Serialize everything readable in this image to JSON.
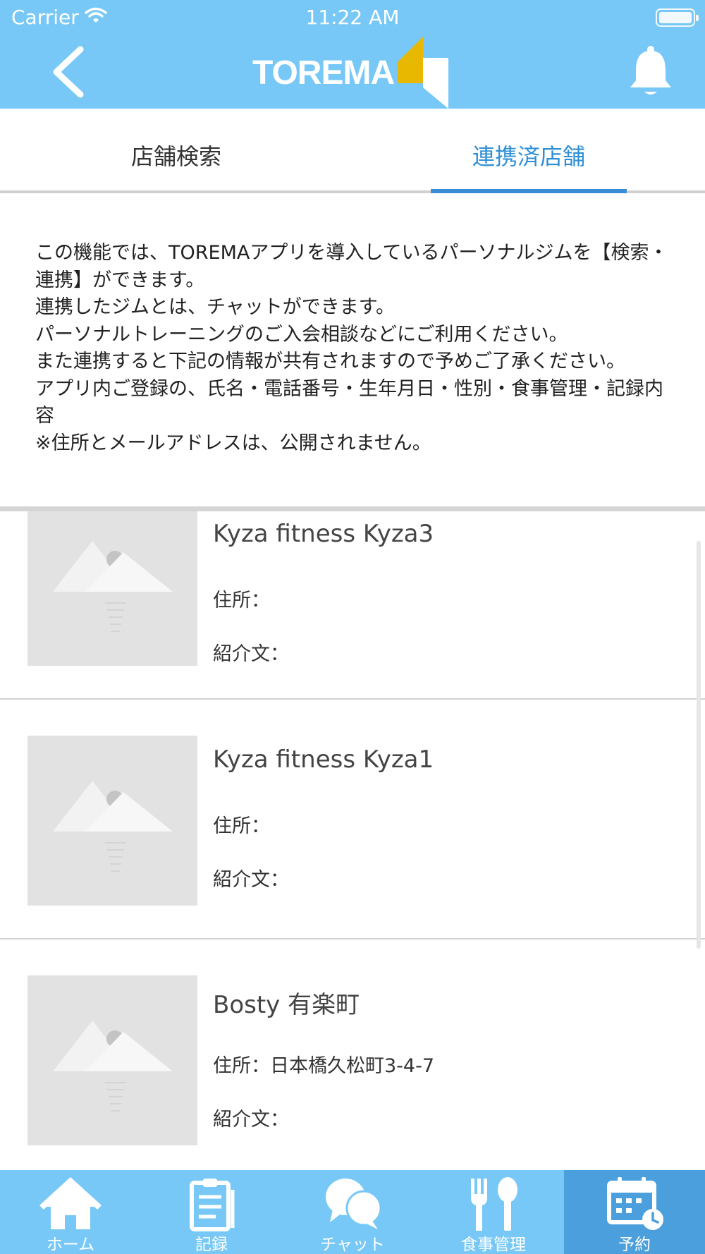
{
  "status_bar": {
    "carrier": "Carrier",
    "time": "11:22 AM"
  },
  "header": {
    "logo_text": "TOREMA"
  },
  "tabs": [
    {
      "label": "店舗検索",
      "active": false
    },
    {
      "label": "連携済店舗",
      "active": true
    }
  ],
  "description": "この機能では、TOREMAアプリを導入しているパーソナルジムを【検索・連携】ができます。\n連携したジムとは、チャットができます。\nパーソナルトレーニングのご入会相談などにご利用ください。\nまた連携すると下記の情報が共有されますので予めご了承ください。\nアプリ内ご登録の、氏名・電話番号・生年月日・性別・食事管理・記録内容\n※住所とメールアドレスは、公開されません。",
  "gyms": [
    {
      "name": "Kyza fitness Kyza3",
      "address": "住所：",
      "intro": "紹介文："
    },
    {
      "name": "Kyza fitness Kyza1",
      "address": "住所：",
      "intro": "紹介文："
    },
    {
      "name": "Bosty 有楽町",
      "address": "住所：日本橋久松町3-4-7",
      "intro": "紹介文："
    }
  ],
  "bottom_nav": [
    {
      "label": "ホーム",
      "icon": "home-icon",
      "active": false
    },
    {
      "label": "記録",
      "icon": "clipboard-icon",
      "active": false
    },
    {
      "label": "チャット",
      "icon": "chat-bubbles-icon",
      "active": false
    },
    {
      "label": "食事管理",
      "icon": "fork-spoon-icon",
      "active": false
    },
    {
      "label": "予約",
      "icon": "calendar-clock-icon",
      "active": true
    }
  ],
  "colors": {
    "header_bg": "#77c8f6",
    "accent": "#3a8ed6",
    "logo_yellow": "#e8b800",
    "nav_active_bg": "#4a9fdc"
  }
}
